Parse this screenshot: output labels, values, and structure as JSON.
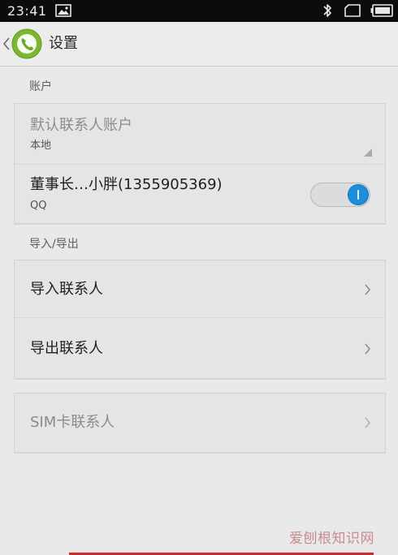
{
  "status_bar": {
    "time": "23:41"
  },
  "app_bar": {
    "title": "设置"
  },
  "sections": {
    "account": {
      "header": "账户",
      "default_account_title": "默认联系人账户",
      "default_account_value": "本地",
      "qq_account_title": "董事长…小胖(1355905369)",
      "qq_account_type": "QQ",
      "qq_account_sync_enabled": true
    },
    "import_export": {
      "header": "导入/导出",
      "import_label": "导入联系人",
      "export_label": "导出联系人"
    },
    "sim": {
      "label": "SIM卡联系人"
    }
  },
  "watermark": "爱刨根知识网",
  "colors": {
    "toggle_on": "#1d8fe0",
    "logo_green": "#7cb82f",
    "watermark": "#c98d8d",
    "bottom_accent": "#d12a2a"
  }
}
